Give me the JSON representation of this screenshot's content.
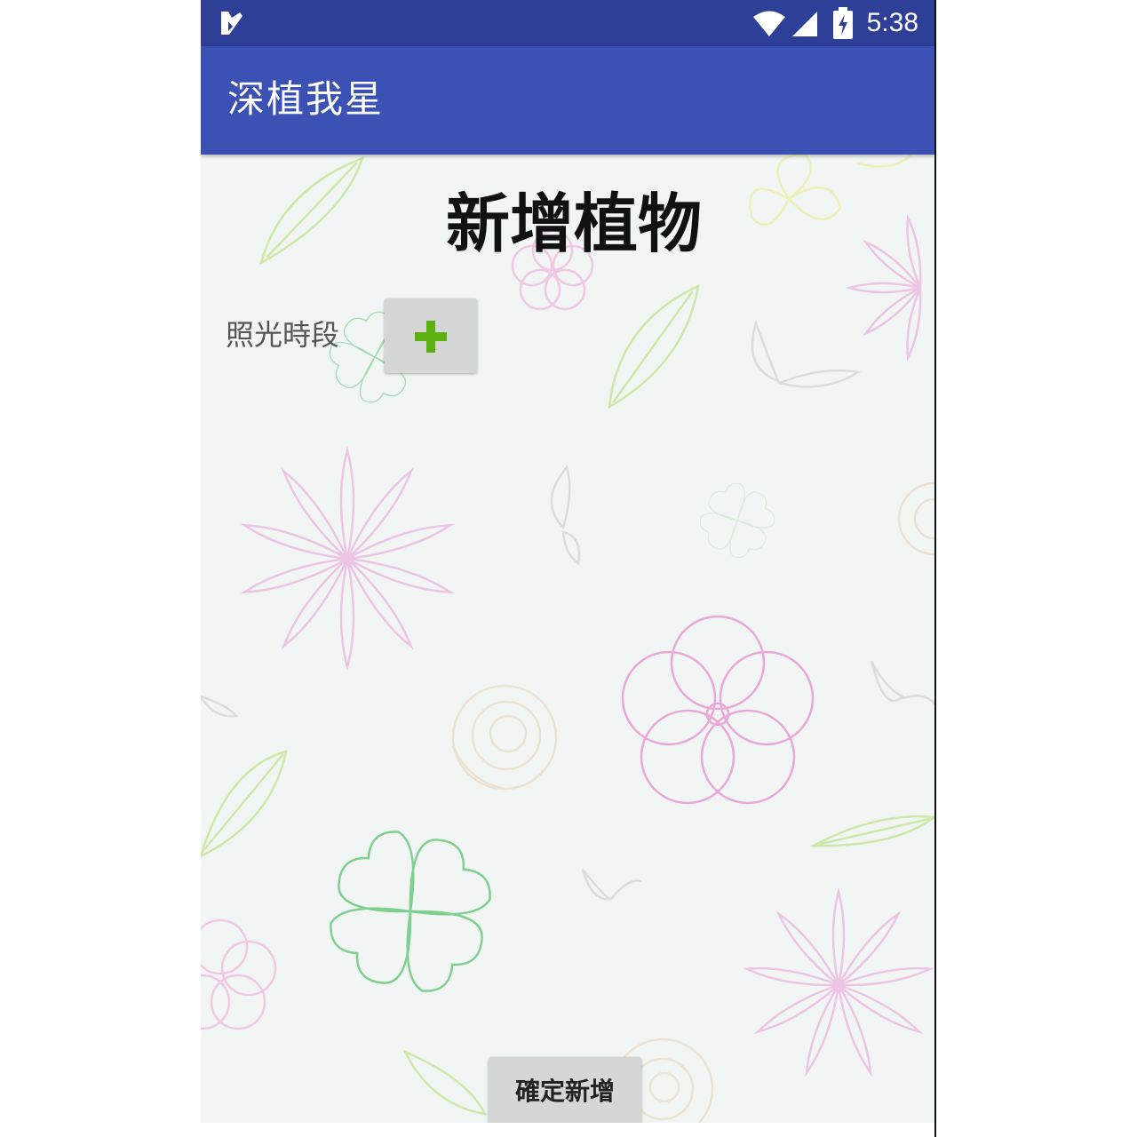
{
  "status_bar": {
    "time": "5:38",
    "background": "#2e3f97",
    "icons": [
      "app-notification-icon",
      "wifi-icon",
      "cell-signal-icon",
      "battery-charging-icon"
    ]
  },
  "app_bar": {
    "title": "深植我星",
    "background": "#3b51b3"
  },
  "main": {
    "title": "新增植物",
    "light_period_label": "照光時段",
    "add_button_icon": "plus-icon",
    "confirm_button_label": "確定新增"
  },
  "colors": {
    "plus": "#5db012",
    "button": "#d5d6d6",
    "background": "#f1f6f5"
  }
}
